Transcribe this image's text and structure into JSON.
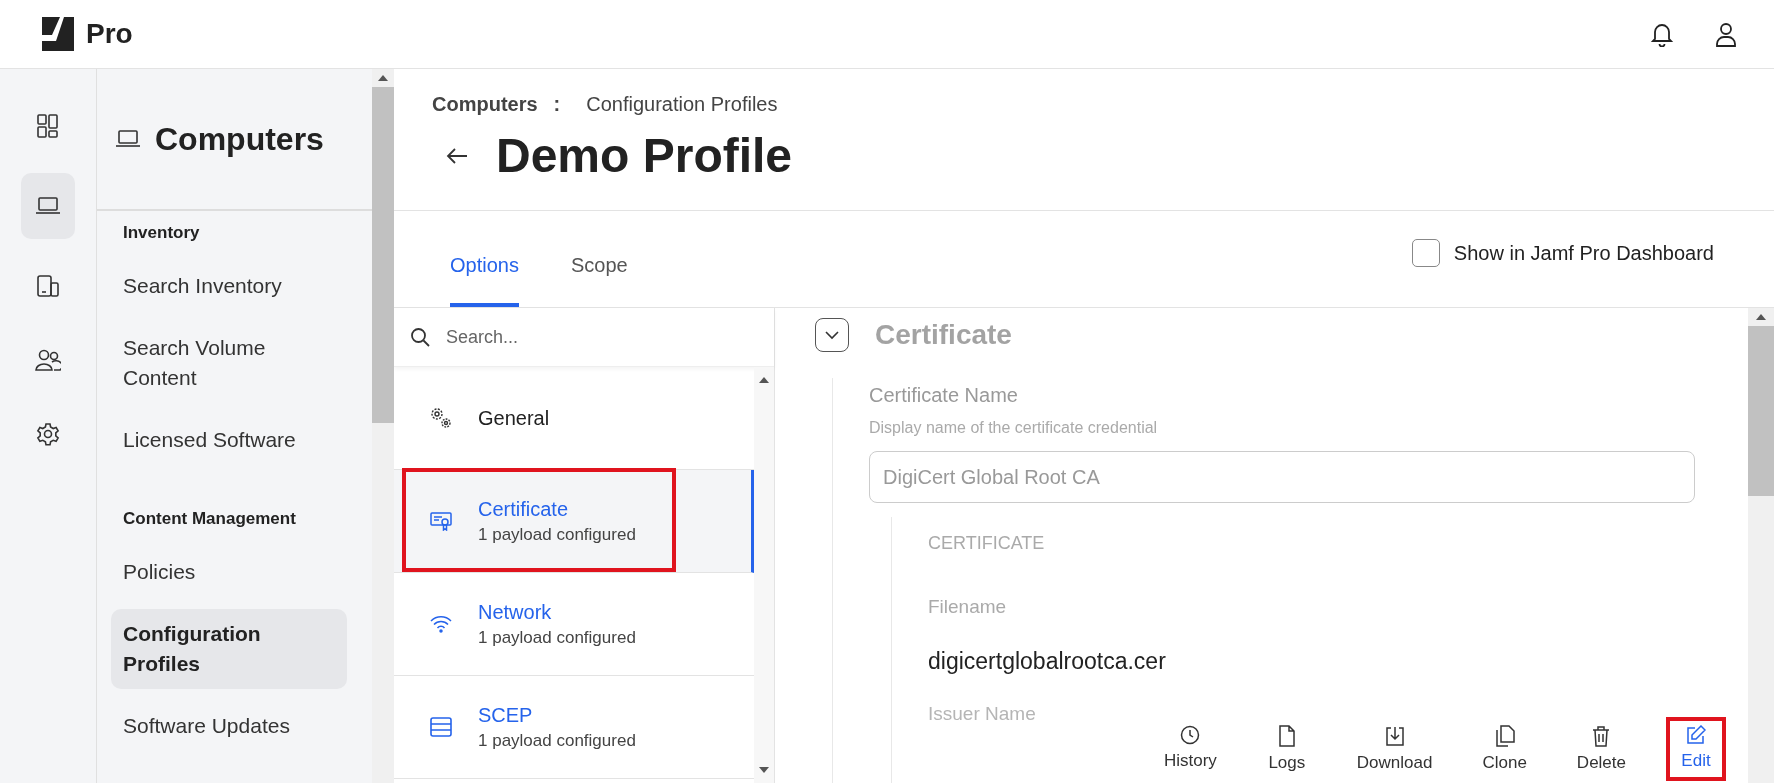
{
  "topbar": {
    "logo_text": "Pro",
    "icons": [
      {
        "kind": "bell"
      },
      {
        "kind": "user"
      }
    ]
  },
  "rail": [
    {
      "kind": "dashboard",
      "selected": false
    },
    {
      "kind": "laptop",
      "selected": true
    },
    {
      "kind": "devices",
      "selected": false
    },
    {
      "kind": "users",
      "selected": false
    },
    {
      "kind": "settings",
      "selected": false
    }
  ],
  "nav": {
    "title": "Computers",
    "sections": [
      {
        "heading": "Inventory",
        "items": [
          {
            "label": "Search Inventory",
            "selected": false
          },
          {
            "label": "Search Volume Content",
            "selected": false
          },
          {
            "label": "Licensed Software",
            "selected": false
          }
        ]
      },
      {
        "heading": "Content Management",
        "items": [
          {
            "label": "Policies",
            "selected": false
          },
          {
            "label": "Configuration Profiles",
            "selected": true
          },
          {
            "label": "Software Updates",
            "selected": false
          }
        ]
      }
    ]
  },
  "breadcrumb": {
    "parent": "Computers",
    "separator": ":",
    "current": "Configuration Profiles"
  },
  "title": "Demo Profile",
  "tabs": [
    {
      "label": "Options",
      "selected": true
    },
    {
      "label": "Scope",
      "selected": false
    }
  ],
  "dashboard_checkbox": {
    "label": "Show in Jamf Pro Dashboard",
    "checked": false
  },
  "payloads": {
    "search": {
      "placeholder": "Search..."
    },
    "items": [
      {
        "kind": "general",
        "title": "General",
        "selected": false,
        "highlighted": false
      },
      {
        "kind": "certificate",
        "title": "Certificate",
        "subtitle": "1 payload configured",
        "selected": true,
        "highlighted": true
      },
      {
        "kind": "network",
        "title": "Network",
        "subtitle": "1 payload configured",
        "selected": false,
        "highlighted": false
      },
      {
        "kind": "scep",
        "title": "SCEP",
        "subtitle": "1 payload configured",
        "selected": false,
        "highlighted": false
      }
    ]
  },
  "section": {
    "title": "Certificate",
    "expanded": true,
    "certificate_name": {
      "label": "Certificate Name",
      "hint": "Display name of the certificate credential",
      "value": "DigiCert Global Root CA"
    },
    "certificate": {
      "heading": "CERTIFICATE",
      "filename_label": "Filename",
      "filename": "digicertglobalrootca.cer",
      "issuer_label": "Issuer Name"
    }
  },
  "actions": [
    {
      "kind": "history",
      "label": "History",
      "highlighted": false
    },
    {
      "kind": "logs",
      "label": "Logs",
      "highlighted": false
    },
    {
      "kind": "download",
      "label": "Download",
      "highlighted": false
    },
    {
      "kind": "clone",
      "label": "Clone",
      "highlighted": false
    },
    {
      "kind": "delete",
      "label": "Delete",
      "highlighted": false
    },
    {
      "kind": "edit",
      "label": "Edit",
      "highlighted": true
    }
  ]
}
